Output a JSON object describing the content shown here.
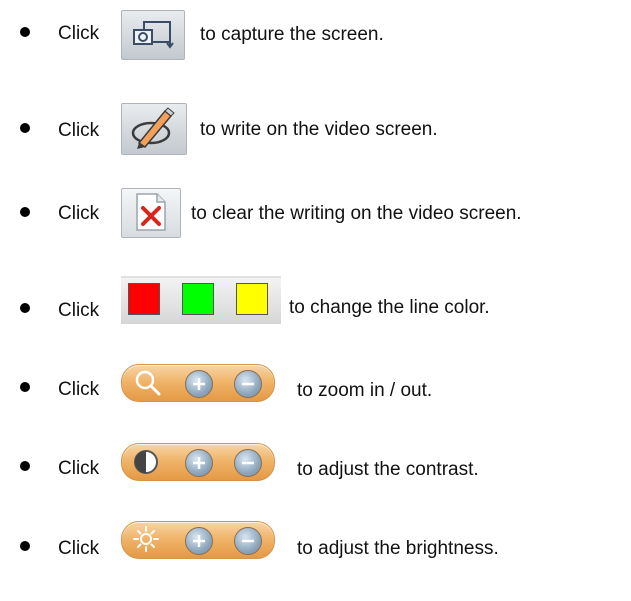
{
  "click_word": "Click",
  "items": [
    {
      "icon": "capture-screen-icon",
      "text": "to capture the screen."
    },
    {
      "icon": "pencil-icon",
      "text": "to write on the video screen."
    },
    {
      "icon": "clear-document-icon",
      "text": "to clear the writing on the video screen."
    },
    {
      "icon": "color-swatches-icon",
      "text": "to change the line color."
    },
    {
      "icon": "zoom-control-icon",
      "text": "to zoom in / out."
    },
    {
      "icon": "contrast-control-icon",
      "text": "to adjust the contrast."
    },
    {
      "icon": "brightness-control-icon",
      "text": "to adjust the brightness."
    }
  ],
  "colors": {
    "swatch_red": "#ff0000",
    "swatch_green": "#00ff00",
    "swatch_yellow": "#ffff00",
    "pill_orange": "#f0b46a"
  }
}
